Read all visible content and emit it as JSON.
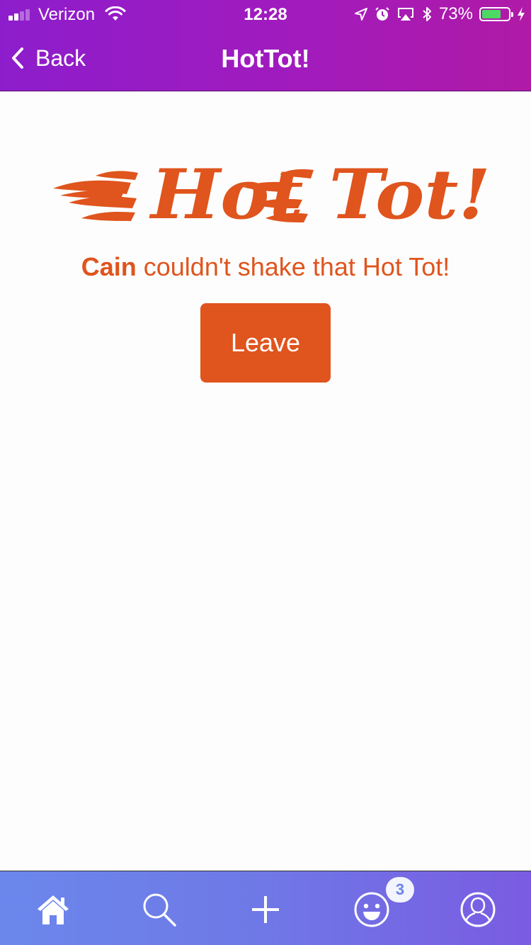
{
  "status_bar": {
    "carrier": "Verizon",
    "time": "12:28",
    "battery_percent": "73%",
    "battery_level": 0.73,
    "signal_bars": 2
  },
  "nav": {
    "back_label": "Back",
    "title": "HotTot!"
  },
  "content": {
    "logo_text": "Hot Tot!",
    "message_name": "Cain",
    "message_text": " couldn't shake that Hot Tot!",
    "leave_label": "Leave"
  },
  "tab_bar": {
    "items": [
      "home-icon",
      "search-icon",
      "plus-icon",
      "smiley-icon",
      "profile-icon"
    ],
    "notification_count": "3"
  },
  "colors": {
    "header_gradient": [
      "#8d1dcc",
      "#b01aa6"
    ],
    "accent": "#e0541d",
    "tab_bar_gradient": [
      "#6b87ec",
      "#7a5be2"
    ],
    "battery_fill": "#4cd964"
  }
}
